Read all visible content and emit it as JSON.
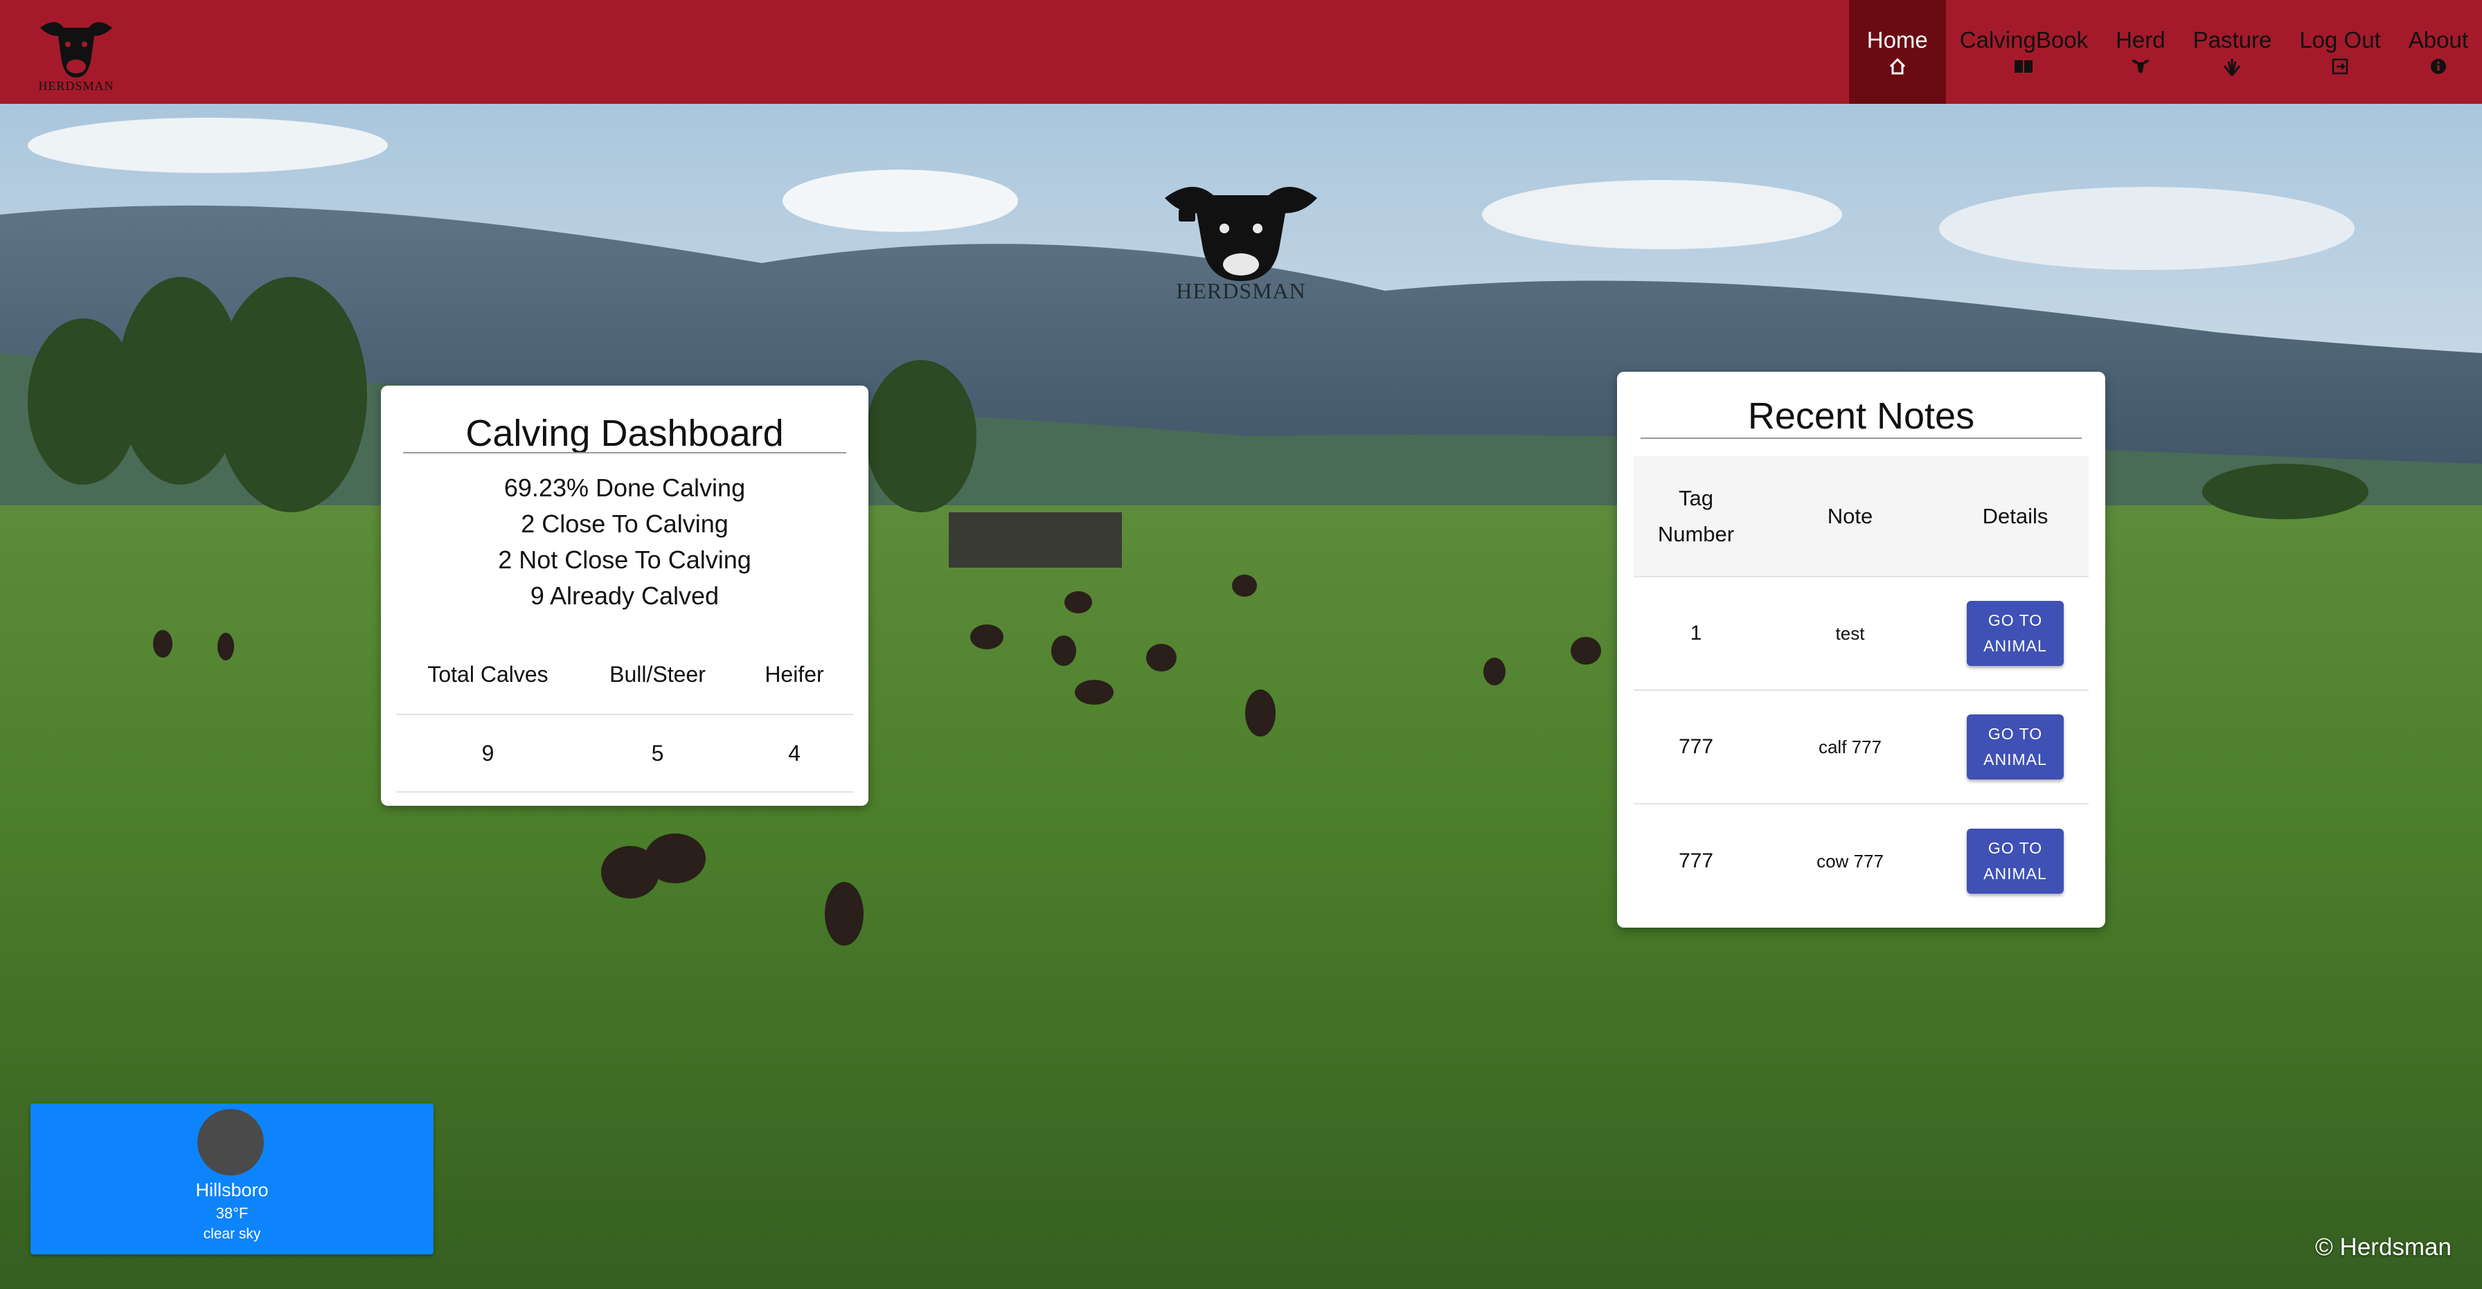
{
  "brand": {
    "logo_text": "HERDSMAN",
    "color": "#a41a2b",
    "active_color": "#6a0a12"
  },
  "nav": {
    "items": [
      {
        "label": "Home",
        "icon": "home-icon",
        "active": true
      },
      {
        "label": "CalvingBook",
        "icon": "book-icon",
        "active": false
      },
      {
        "label": "Herd",
        "icon": "cow-icon",
        "active": false
      },
      {
        "label": "Pasture",
        "icon": "grass-icon",
        "active": false
      },
      {
        "label": "Log Out",
        "icon": "logout-icon",
        "active": false
      },
      {
        "label": "About",
        "icon": "info-icon",
        "active": false
      }
    ]
  },
  "center_logo": {
    "text": "HERDSMAN"
  },
  "dashboard": {
    "title": "Calving Dashboard",
    "stats": [
      "69.23% Done Calving",
      "2 Close To Calving",
      "2 Not Close To Calving",
      "9 Already Calved"
    ],
    "table": {
      "headers": [
        "Total Calves",
        "Bull/Steer",
        "Heifer"
      ],
      "row": [
        "9",
        "5",
        "4"
      ]
    }
  },
  "notes": {
    "title": "Recent Notes",
    "headers": [
      "Tag\nNumber",
      "Note",
      "Details"
    ],
    "rows": [
      {
        "tag": "1",
        "note": "test",
        "button": "GO TO\nANIMAL"
      },
      {
        "tag": "777",
        "note": "calf 777",
        "button": "GO TO\nANIMAL"
      },
      {
        "tag": "777",
        "note": "cow 777",
        "button": "GO TO\nANIMAL"
      }
    ],
    "button_color": "#3f51b5"
  },
  "weather": {
    "city": "Hillsboro",
    "temp": "38°F",
    "description": "clear sky",
    "icon": "weather-icon",
    "color": "#0d84fb"
  },
  "footer": {
    "text": "© Herdsman"
  }
}
